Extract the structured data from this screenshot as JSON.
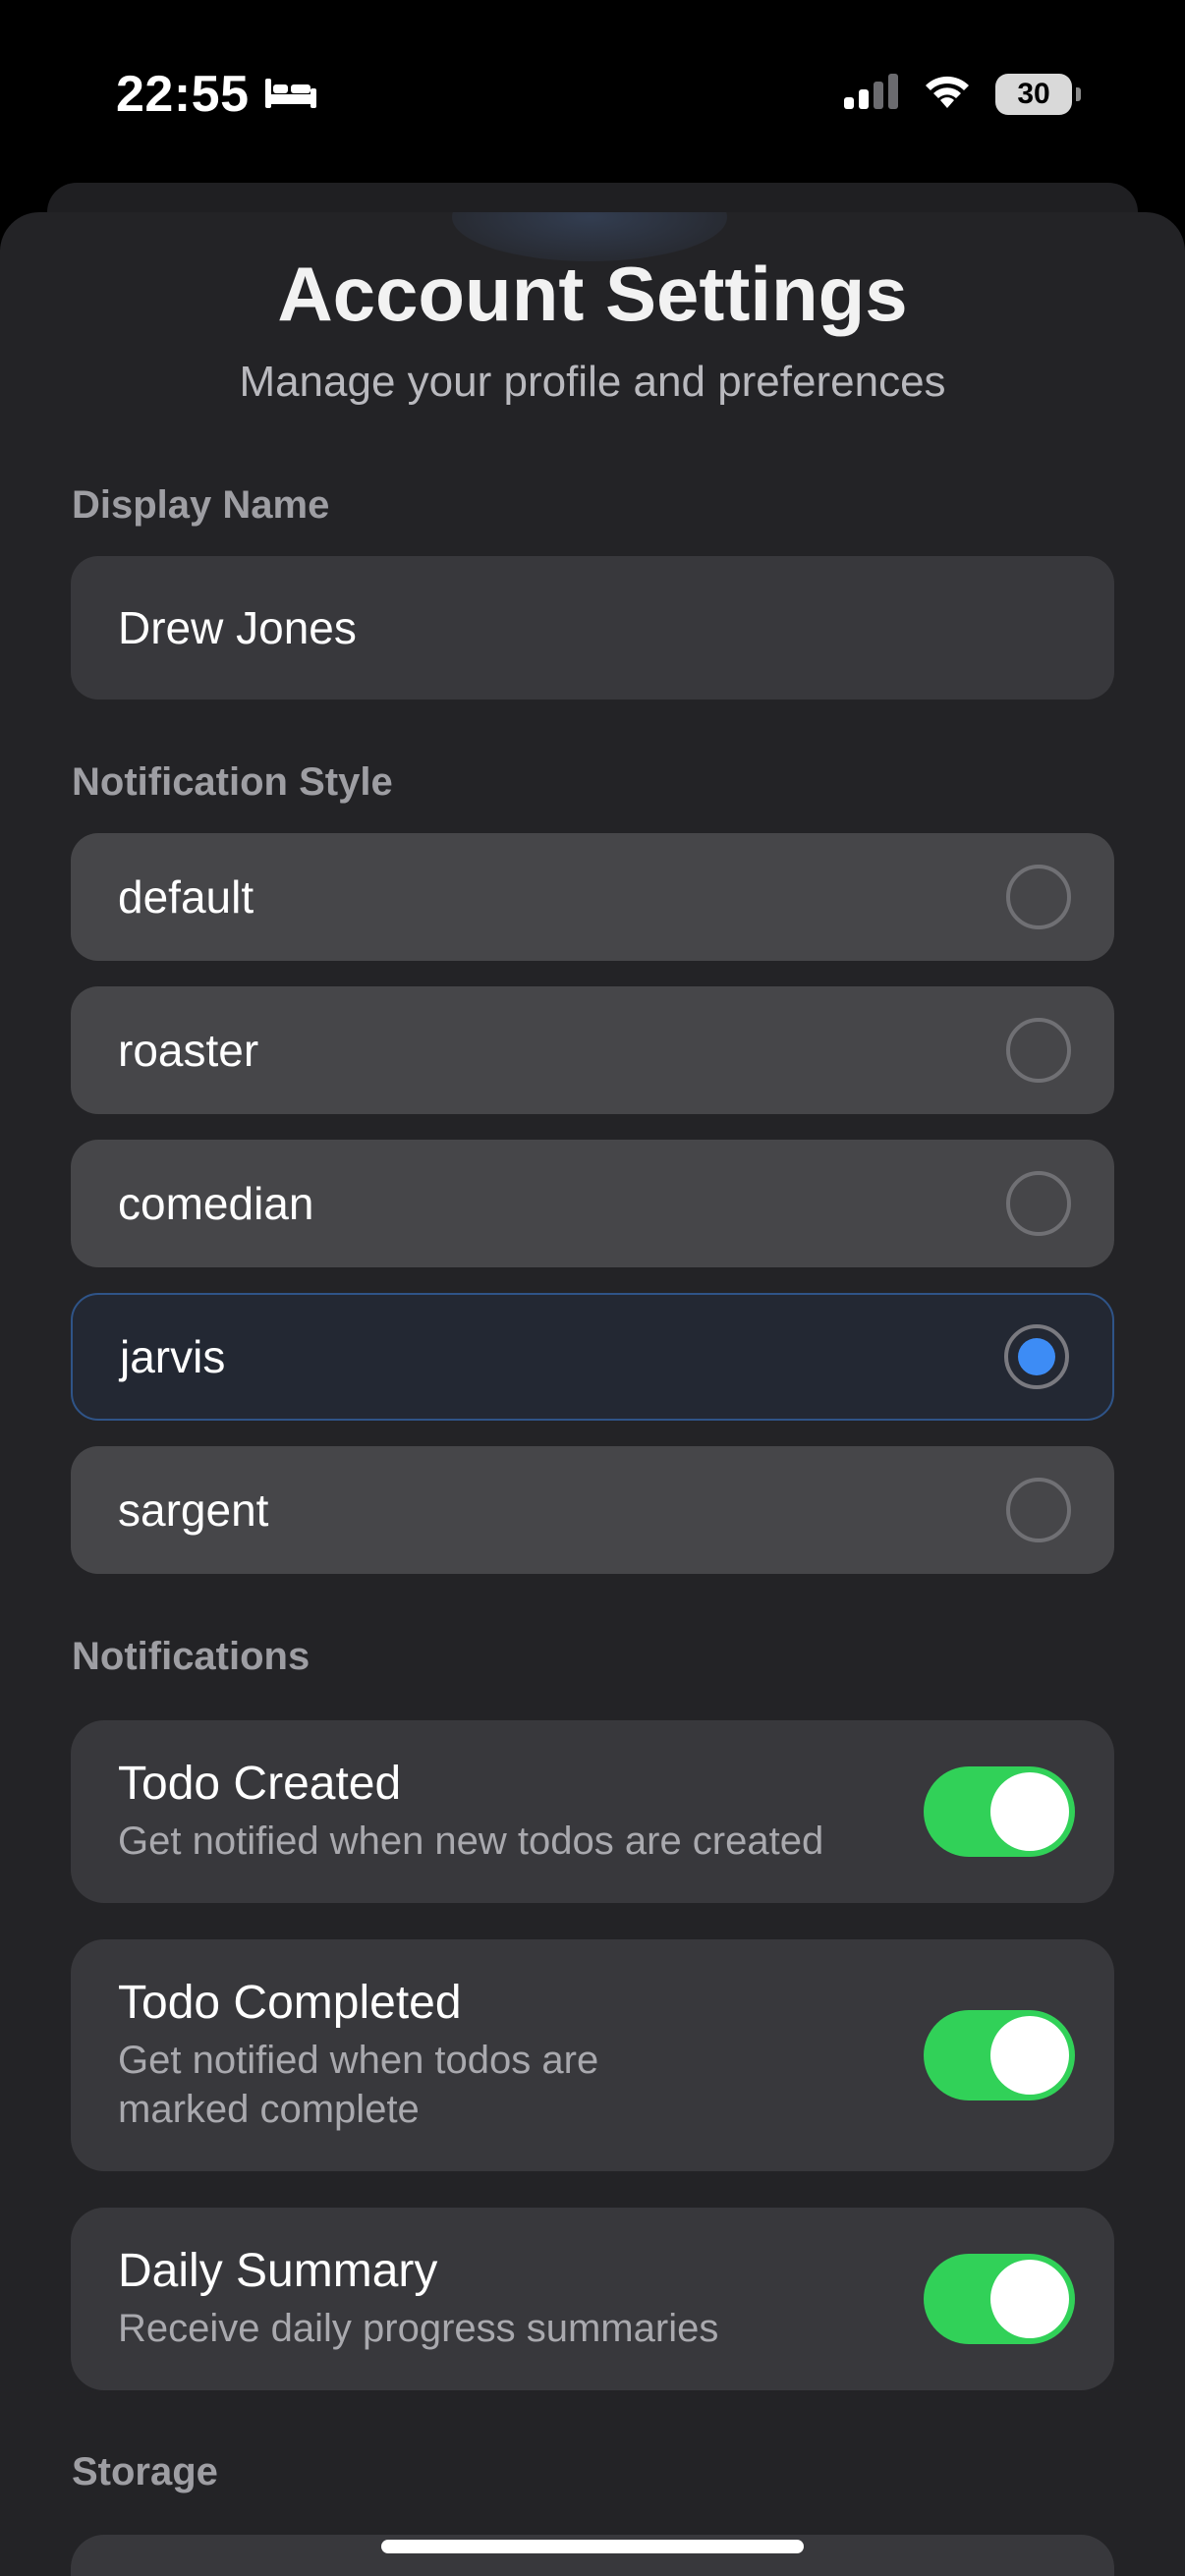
{
  "status_bar": {
    "time": "22:55",
    "focus_icon": "bed-icon",
    "signal_icon": "cellular-signal-icon",
    "wifi_icon": "wifi-icon",
    "battery_percent": "30",
    "battery_level": 0.3
  },
  "header": {
    "title": "Account Settings",
    "subtitle": "Manage your profile and preferences"
  },
  "display_name": {
    "label": "Display Name",
    "value": "Drew Jones"
  },
  "notification_style": {
    "label": "Notification Style",
    "selected": "jarvis",
    "options": [
      {
        "label": "default",
        "selected": false
      },
      {
        "label": "roaster",
        "selected": false
      },
      {
        "label": "comedian",
        "selected": false
      },
      {
        "label": "jarvis",
        "selected": true
      },
      {
        "label": "sargent",
        "selected": false
      }
    ]
  },
  "notifications": {
    "label": "Notifications",
    "items": [
      {
        "title": "Todo Created",
        "description": "Get notified when new todos are created",
        "enabled": true
      },
      {
        "title": "Todo Completed",
        "description_lines": [
          "Get notified when todos are",
          "marked complete"
        ],
        "enabled": true
      },
      {
        "title": "Daily Summary",
        "description": "Receive daily progress summaries",
        "enabled": true
      }
    ]
  },
  "storage": {
    "label": "Storage"
  },
  "colors": {
    "accent_blue": "#3d8cf5",
    "toggle_on": "#31d158",
    "sheet_bg": "#232326",
    "card_bg": "#38383c"
  }
}
